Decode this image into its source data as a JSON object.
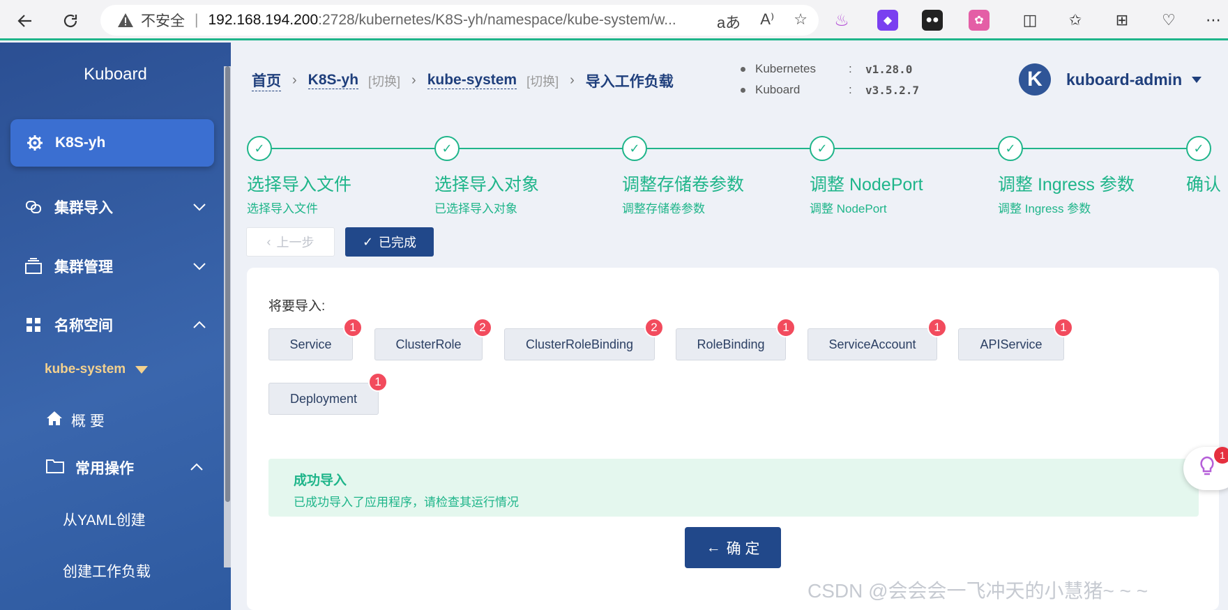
{
  "browser": {
    "insecure_label": "不安全",
    "separator": "|",
    "url_host": "192.168.194.200",
    "url_path": ":2728/kubernetes/K8S-yh/namespace/kube-system/w...",
    "icons": [
      "back-icon",
      "refresh-icon",
      "warning-icon",
      "read-aloud-icon",
      "favorite-icon",
      "split-screen-icon",
      "favorites-icon",
      "collections-icon",
      "browser-essentials-icon",
      "more-icon"
    ]
  },
  "sidebar": {
    "brand": "Kuboard",
    "cluster": "K8S-yh",
    "items": [
      {
        "label": "集群导入",
        "icon": "link-icon"
      },
      {
        "label": "集群管理",
        "icon": "stack-icon"
      },
      {
        "label": "名称空间",
        "icon": "grid-icon"
      }
    ],
    "namespace": "kube-system",
    "overview": "概 要",
    "common_ops": "常用操作",
    "sub_items": [
      "从YAML创建",
      "创建工作负载"
    ]
  },
  "breadcrumb": {
    "home": "首页",
    "cluster": "K8S-yh",
    "cluster_switch": "[切换]",
    "namespace": "kube-system",
    "namespace_switch": "[切换]",
    "current": "导入工作负载"
  },
  "versions": [
    {
      "name": "Kubernetes",
      "colon": ":",
      "value": "v1.28.0"
    },
    {
      "name": "Kuboard",
      "colon": ":",
      "value": "v3.5.2.7"
    }
  ],
  "user": {
    "avatar_letter": "K",
    "name": "kuboard-admin"
  },
  "steps": [
    {
      "title": "选择导入文件",
      "desc": "选择导入文件"
    },
    {
      "title": "选择导入对象",
      "desc": "已选择导入对象"
    },
    {
      "title": "调整存储卷参数",
      "desc": "调整存储卷参数"
    },
    {
      "title": "调整 NodePort",
      "desc": "调整 NodePort"
    },
    {
      "title": "调整 Ingress 参数",
      "desc": "调整 Ingress 参数"
    },
    {
      "title": "确认",
      "desc": ""
    }
  ],
  "buttons": {
    "prev": "上一步",
    "done": "已完成",
    "ok": "确 定"
  },
  "import": {
    "label": "将要导入:",
    "resources": [
      {
        "name": "Service",
        "count": "1"
      },
      {
        "name": "ClusterRole",
        "count": "2"
      },
      {
        "name": "ClusterRoleBinding",
        "count": "2"
      },
      {
        "name": "RoleBinding",
        "count": "1"
      },
      {
        "name": "ServiceAccount",
        "count": "1"
      },
      {
        "name": "APIService",
        "count": "1"
      },
      {
        "name": "Deployment",
        "count": "1"
      }
    ]
  },
  "success": {
    "title": "成功导入",
    "desc": "已成功导入了应用程序，请检查其运行情况"
  },
  "helper_badge": "1",
  "watermark": "CSDN @会会会一飞冲天的小慧猪~ ~ ~"
}
